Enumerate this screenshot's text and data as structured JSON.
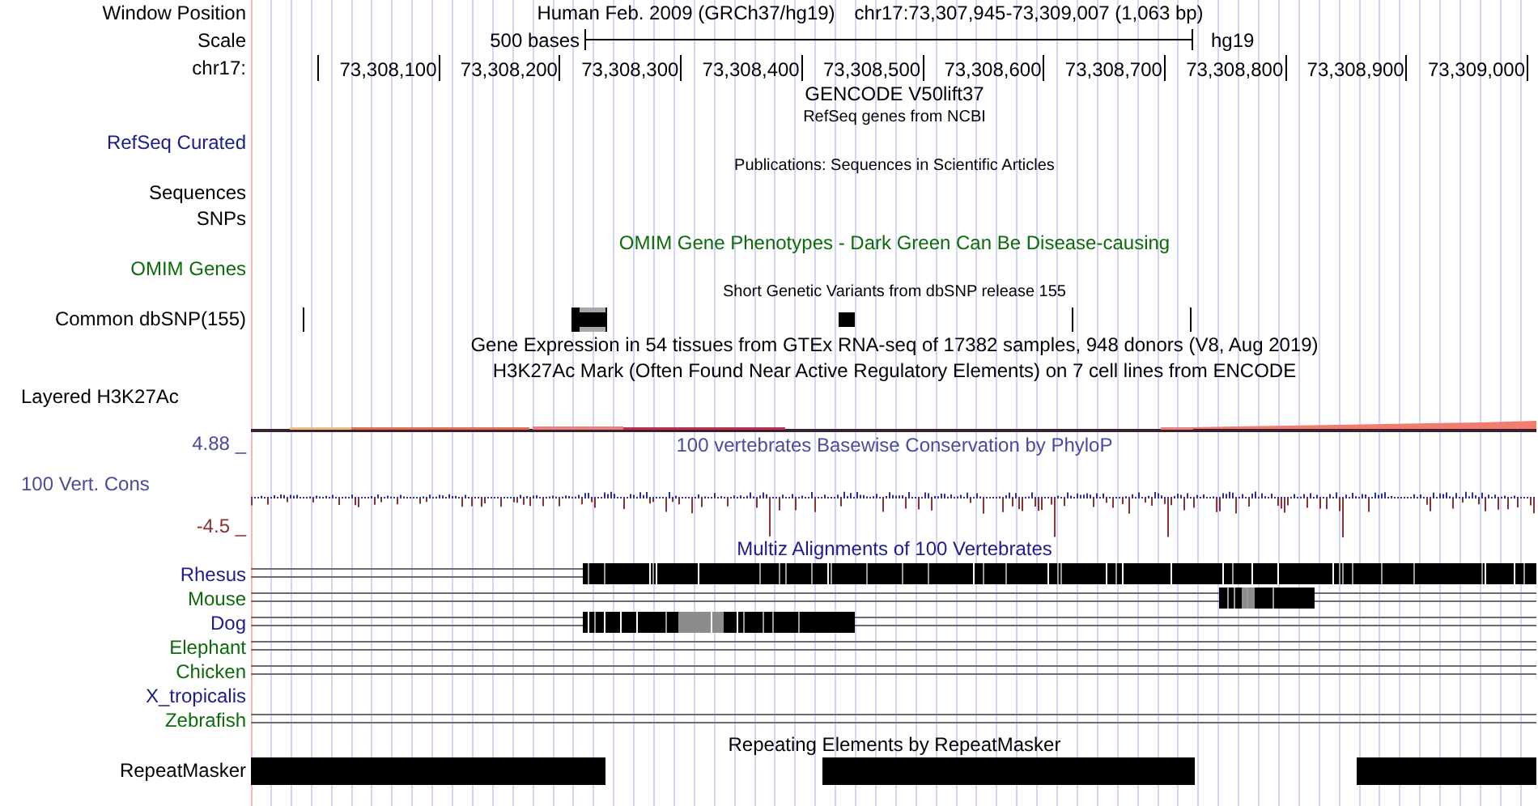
{
  "position": {
    "label": "Window Position",
    "assembly": "Human Feb. 2009 (GRCh37/hg19)",
    "range": "chr17:73,307,945-73,309,007 (1,063 bp)"
  },
  "scale": {
    "label": "Scale",
    "length": "500 bases",
    "assembly": "hg19"
  },
  "ruler": {
    "label": "chr17:",
    "ticks": [
      "73,308,100",
      "73,308,200",
      "73,308,300",
      "73,308,400",
      "73,308,500",
      "73,308,600",
      "73,308,700",
      "73,308,800",
      "73,308,900",
      "73,309,000"
    ]
  },
  "rows": [
    {
      "kind": "header",
      "text": "GENCODE V50lift37",
      "color": "#000000"
    },
    {
      "kind": "caption",
      "text": "RefSeq genes from NCBI"
    },
    {
      "kind": "label",
      "label": "RefSeq Curated",
      "color": "#1c1c8a"
    },
    {
      "kind": "caption",
      "text": "Publications: Sequences in Scientific Articles"
    },
    {
      "kind": "label",
      "label": "Sequences",
      "color": "#000000"
    },
    {
      "kind": "label",
      "label": "SNPs",
      "color": "#000000"
    },
    {
      "kind": "header",
      "text": "OMIM Gene Phenotypes - Dark Green Can Be Disease-causing",
      "color": "#0b6b0b"
    },
    {
      "kind": "label",
      "label": "OMIM Genes",
      "color": "#0b6b0b"
    },
    {
      "kind": "caption",
      "text": "Short Genetic Variants from dbSNP release 155"
    },
    {
      "kind": "snp",
      "label": "Common dbSNP(155)",
      "color": "#000000"
    },
    {
      "kind": "header",
      "text": "Gene Expression in 54 tissues from GTEx RNA-seq of 17382 samples, 948 donors (V8, Aug 2019)",
      "color": "#000000"
    },
    {
      "kind": "header",
      "text": "H3K27Ac Mark (Often Found Near Active Regulatory Elements) on 7 cell lines from ENCODE",
      "color": "#000000"
    },
    {
      "kind": "density",
      "label": "Layered H3K27Ac",
      "color": "#000000"
    },
    {
      "kind": "wiggle",
      "title": "100 vertebrates Basewise Conservation by PhyloP",
      "label": "100 Vert. Cons",
      "max": "4.88 _",
      "min": "-4.5 _",
      "color": "#4b4b9e"
    },
    {
      "kind": "header",
      "text": "Multiz Alignments of 100 Vertebrates",
      "color": "#1c1c8a"
    },
    {
      "kind": "alignment",
      "label": "Rhesus",
      "color": "#1c1c8a"
    },
    {
      "kind": "alignment",
      "label": "Mouse",
      "color": "#0b6b0b"
    },
    {
      "kind": "alignment",
      "label": "Dog",
      "color": "#1c1c8a"
    },
    {
      "kind": "alignment",
      "label": "Elephant",
      "color": "#0b6b0b"
    },
    {
      "kind": "alignment",
      "label": "Chicken",
      "color": "#0b6b0b"
    },
    {
      "kind": "alignment",
      "label": "X_tropicalis",
      "color": "#1c1c8a"
    },
    {
      "kind": "alignment",
      "label": "Zebrafish",
      "color": "#0b6b0b"
    },
    {
      "kind": "header",
      "text": "Repeating Elements by RepeatMasker",
      "color": "#000000"
    },
    {
      "kind": "repeat",
      "label": "RepeatMasker",
      "color": "#000000"
    }
  ]
}
